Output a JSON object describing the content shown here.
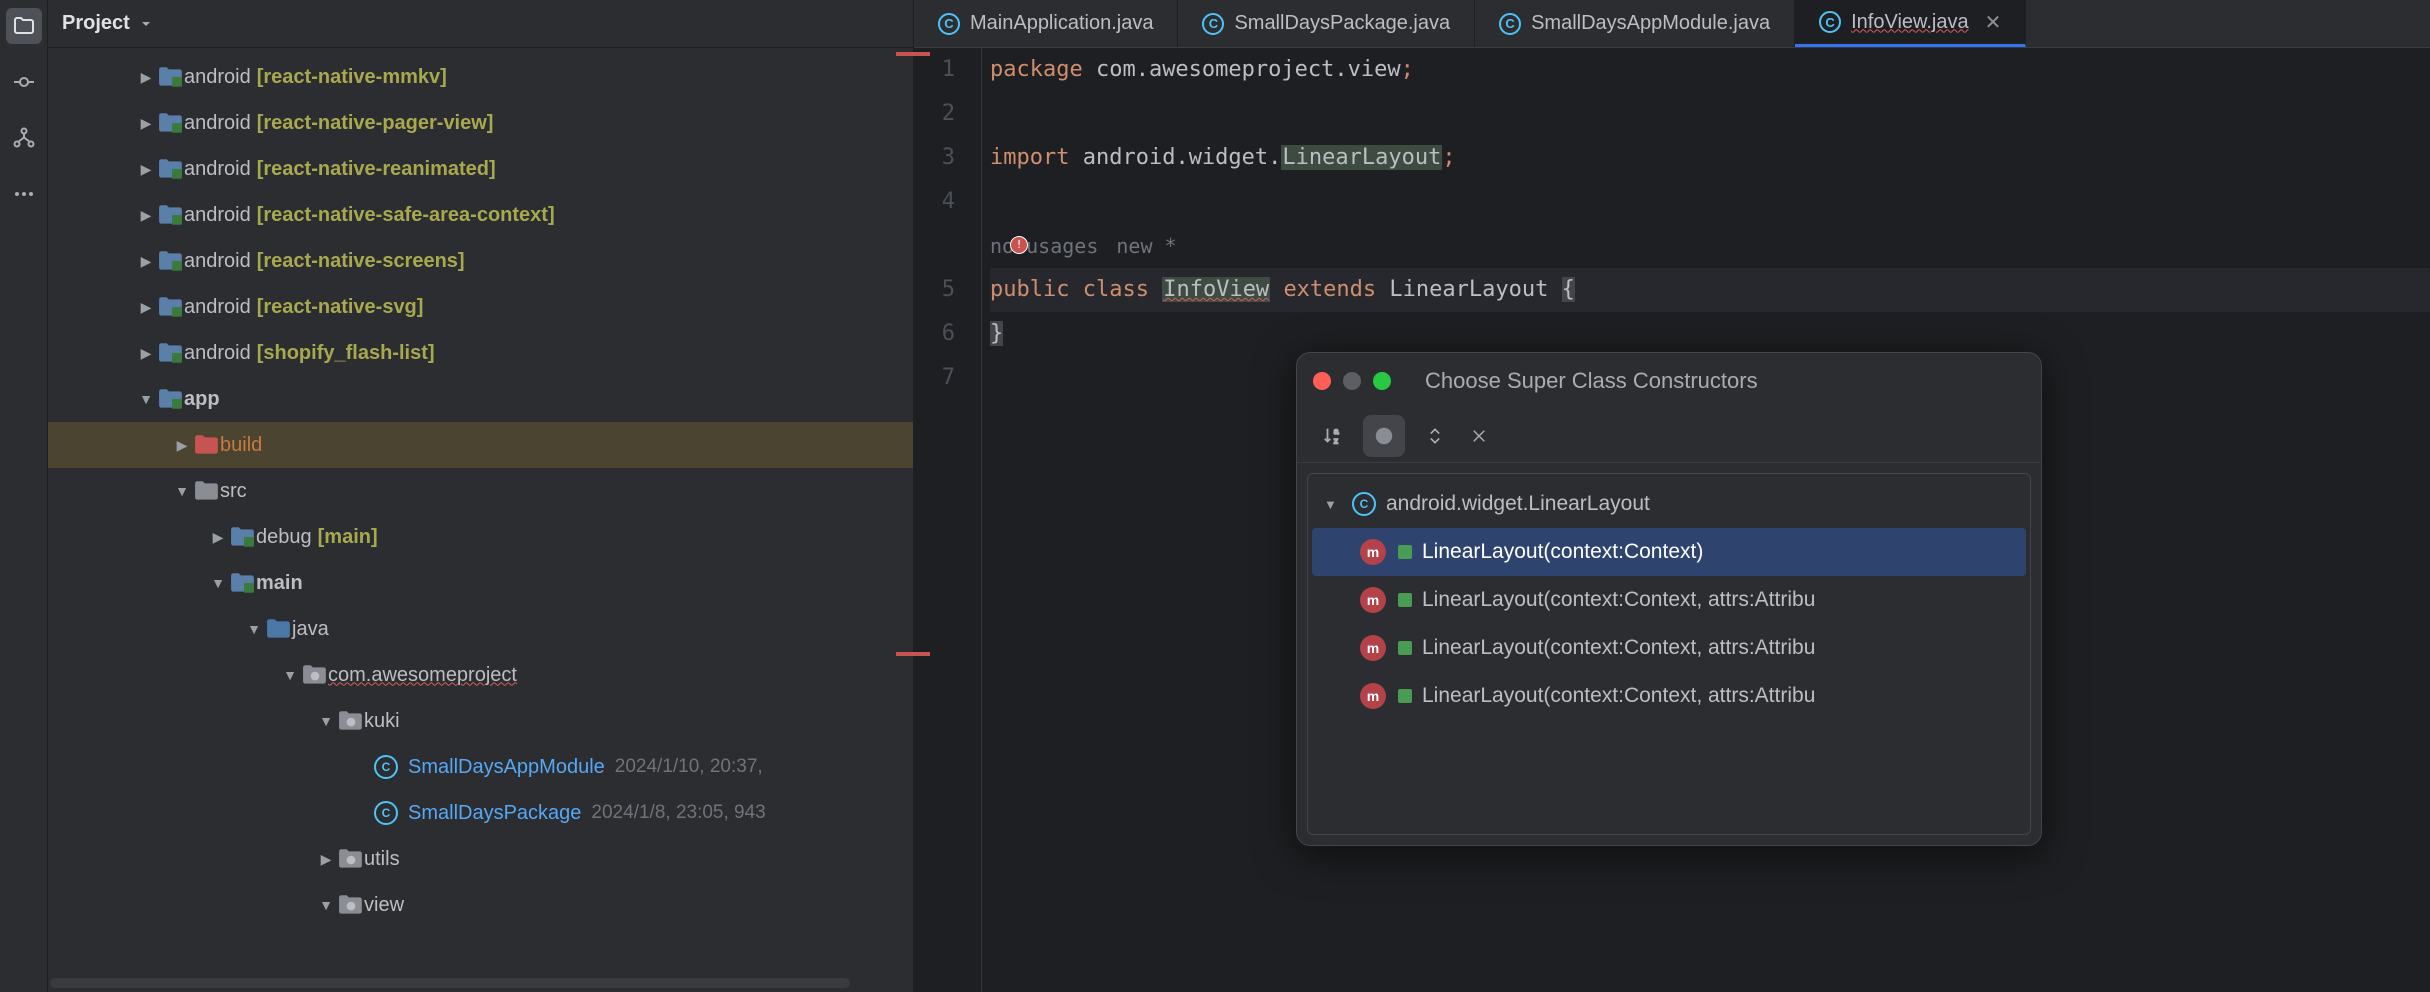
{
  "sidebar": {
    "title": "Project",
    "tree": {
      "mods": [
        {
          "label": "android",
          "suffix": "[react-native-mmkv]"
        },
        {
          "label": "android",
          "suffix": "[react-native-pager-view]"
        },
        {
          "label": "android",
          "suffix": "[react-native-reanimated]"
        },
        {
          "label": "android",
          "suffix": "[react-native-safe-area-context]"
        },
        {
          "label": "android",
          "suffix": "[react-native-screens]"
        },
        {
          "label": "android",
          "suffix": "[react-native-svg]"
        },
        {
          "label": "android",
          "suffix": "[shopify_flash-list]"
        }
      ],
      "app": "app",
      "build": "build",
      "src": "src",
      "debug": "debug",
      "debug_suffix": "[main]",
      "main": "main",
      "java": "java",
      "pkg": "com.awesomeproject",
      "kuki": "kuki",
      "file1": "SmallDaysAppModule",
      "file1_meta": "2024/1/10, 20:37,",
      "file2": "SmallDaysPackage",
      "file2_meta": "2024/1/8, 23:05, 943",
      "utils": "utils",
      "view": "view"
    }
  },
  "tabs": [
    {
      "label": "MainApplication.java",
      "active": false
    },
    {
      "label": "SmallDaysPackage.java",
      "active": false
    },
    {
      "label": "SmallDaysAppModule.java",
      "active": false
    },
    {
      "label": "InfoView.java",
      "active": true,
      "wavy": true
    }
  ],
  "code": {
    "lines": [
      "1",
      "2",
      "3",
      "4",
      "",
      "5",
      "6",
      "7"
    ],
    "l1_kw": "package",
    "l1_rest": " com.awesomeproject.view",
    "l1_semi": ";",
    "l3_kw": "import",
    "l3_rest": " android.widget.",
    "l3_type": "LinearLayout",
    "l3_semi": ";",
    "inlay_usages": "no usages",
    "inlay_new": "new *",
    "l5_public": "public",
    "l5_class": "class",
    "l5_name": "InfoView",
    "l5_extends": "extends",
    "l5_super": "LinearLayout",
    "l5_brace": "{",
    "l6_brace": "}"
  },
  "popup": {
    "title": "Choose Super Class Constructors",
    "parent": "android.widget.LinearLayout",
    "items": [
      "LinearLayout(context:Context)",
      "LinearLayout(context:Context, attrs:Attribu",
      "LinearLayout(context:Context, attrs:Attribu",
      "LinearLayout(context:Context, attrs:Attribu"
    ]
  }
}
